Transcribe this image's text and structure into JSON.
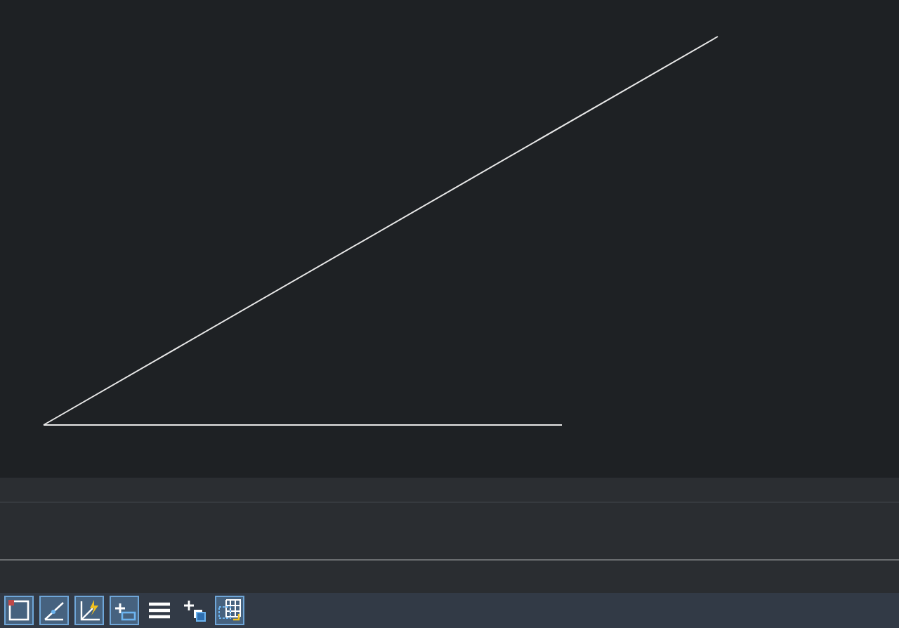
{
  "status_bar": {
    "buttons": [
      {
        "kind": "grid",
        "on": true
      },
      {
        "kind": "polar",
        "on": true
      },
      {
        "kind": "dynamic-ucs",
        "on": true
      },
      {
        "kind": "dynamic-input",
        "on": true
      },
      {
        "kind": "lineweight",
        "on": false
      },
      {
        "kind": "selection-cycling",
        "on": false
      },
      {
        "kind": "annotation-monitor",
        "on": true
      }
    ]
  }
}
